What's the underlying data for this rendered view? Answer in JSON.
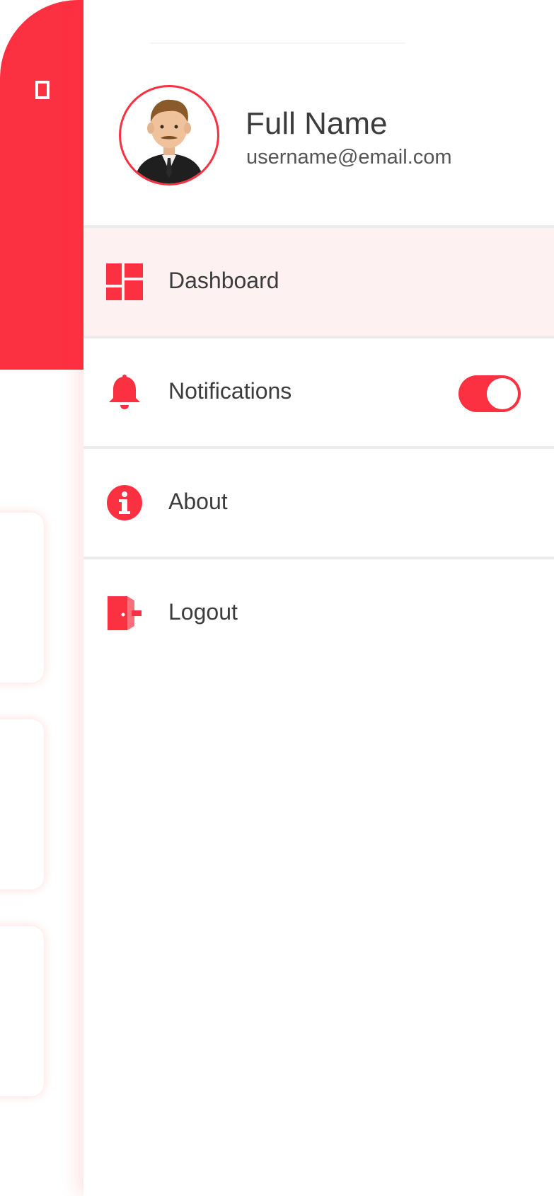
{
  "colors": {
    "accent": "#fb3040",
    "active_row_bg": "#fdf1f2",
    "divider": "#ececec",
    "text_primary": "#3c3c3c"
  },
  "profile": {
    "name": "Full Name",
    "email": "username@email.com",
    "avatar_icon": "businessman-avatar"
  },
  "menu": {
    "items": [
      {
        "label": "Dashboard",
        "icon": "dashboard-icon",
        "active": true
      },
      {
        "label": "Notifications",
        "icon": "bell-icon",
        "toggle": true,
        "toggle_on": true
      },
      {
        "label": "About",
        "icon": "info-icon"
      },
      {
        "label": "Logout",
        "icon": "logout-icon"
      }
    ]
  },
  "background_header": {
    "menu_icon": "menu-icon"
  }
}
